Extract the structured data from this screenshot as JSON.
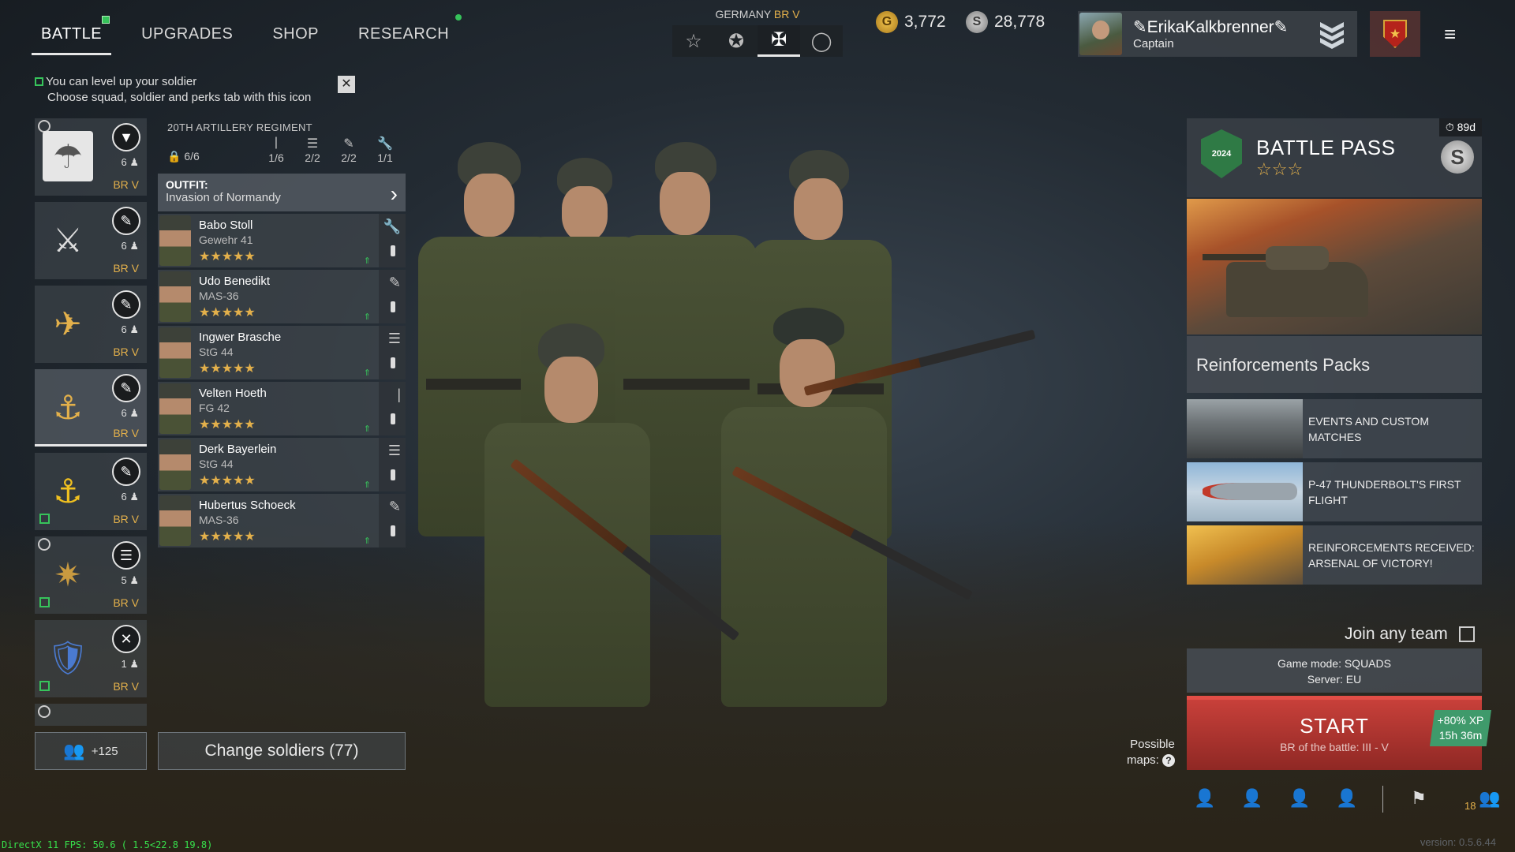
{
  "nav": {
    "tabs": [
      {
        "label": "BATTLE"
      },
      {
        "label": "UPGRADES"
      },
      {
        "label": "SHOP"
      },
      {
        "label": "RESEARCH"
      }
    ]
  },
  "hint": {
    "line1": "You can level up your soldier",
    "line2": "Choose squad, soldier and perks tab with this icon",
    "close": "✕"
  },
  "nation": {
    "label": "GERMANY",
    "br": "BR V",
    "buttons": [
      "☆",
      "✪",
      "✠",
      "◯"
    ]
  },
  "currency": {
    "gold": "3,772",
    "silver": "28,778",
    "gold_symbol": "G",
    "silver_symbol": "S"
  },
  "profile": {
    "name": "✎ErikaKalkbrenner✎",
    "rank": "Captain",
    "rank_icon": "chevron-stack-icon",
    "menu": "≡"
  },
  "squads": [
    {
      "emblem": "☂",
      "cls": "▼",
      "count": "6 ♟",
      "br": "BR V"
    },
    {
      "emblem": "⚔",
      "cls": "✎",
      "count": "6 ♟",
      "br": "BR V"
    },
    {
      "emblem": "✈",
      "cls": "✎",
      "count": "6 ♟",
      "br": "BR V"
    },
    {
      "emblem": "⚓",
      "cls": "✎",
      "count": "6 ♟",
      "br": "BR V"
    },
    {
      "emblem": "⚓",
      "cls": "✎",
      "count": "6 ♟",
      "br": "BR V"
    },
    {
      "emblem": "✷",
      "cls": "☰",
      "count": "5 ♟",
      "br": "BR V"
    },
    {
      "emblem": "🛡",
      "cls": "✕",
      "count": "1 ♟",
      "br": "BR V"
    }
  ],
  "squad_detail": {
    "regiment": "20TH ARTILLERY REGIMENT",
    "slots": [
      {
        "icon": "♟",
        "value": "6/6"
      },
      {
        "icon": "|",
        "value": "1/6"
      },
      {
        "icon": "☰",
        "value": "2/2"
      },
      {
        "icon": "✎",
        "value": "2/2"
      },
      {
        "icon": "🔧",
        "value": "1/1"
      }
    ],
    "outfit_label": "OUTFIT:",
    "outfit_value": "Invasion of Normandy",
    "soldiers": [
      {
        "name": "Babo Stoll",
        "weapon": "Gewehr 41",
        "stars": "★★★★★",
        "role": "🔧"
      },
      {
        "name": "Udo Benedikt",
        "weapon": "MAS-36",
        "stars": "★★★★★",
        "role": "✎"
      },
      {
        "name": "Ingwer Brasche",
        "weapon": "StG 44",
        "stars": "★★★★★",
        "role": "☰"
      },
      {
        "name": "Velten Hoeth",
        "weapon": "FG 42",
        "stars": "★★★★★",
        "role": "|"
      },
      {
        "name": "Derk Bayerlein",
        "weapon": "StG 44",
        "stars": "★★★★★",
        "role": "☰"
      },
      {
        "name": "Hubertus Schoeck",
        "weapon": "MAS-36",
        "stars": "★★★★★",
        "role": "✎"
      }
    ]
  },
  "bottom": {
    "reinforce": "+125",
    "change_soldiers": "Change soldiers (77)"
  },
  "battle_pass": {
    "title": "BATTLE PASS",
    "stars": "☆☆☆",
    "timer": "⏱ 89d",
    "year": "2024",
    "coin": "S"
  },
  "reinforcements": {
    "title": "Reinforcements Packs"
  },
  "events": [
    {
      "title": "EVENTS AND CUSTOM MATCHES"
    },
    {
      "title": "P-47 THUNDERBOLT'S FIRST FLIGHT"
    },
    {
      "title": "REINFORCEMENTS RECEIVED: ARSENAL OF VICTORY!"
    }
  ],
  "match": {
    "join_any": "Join any team",
    "mode": "Game mode: SQUADS",
    "server": "Server: EU",
    "start": "START",
    "br_battle": "BR of the battle: III - V",
    "xp_bonus": "+80% XP",
    "xp_time": "15h 36m",
    "maps_label_1": "Possible",
    "maps_label_2": "maps:",
    "maps_help": "?"
  },
  "social": {
    "friends_count": "18"
  },
  "footer": {
    "fps": "DirectX 11 FPS: 50.6 ( 1.5<22.8 19.8)",
    "version": "version: 0.5.6.44"
  },
  "colors": {
    "accent_gold": "#e3b04b",
    "start_red": "#c8403a",
    "xp_green": "#3f9a6b",
    "level_green": "#37c45b"
  }
}
